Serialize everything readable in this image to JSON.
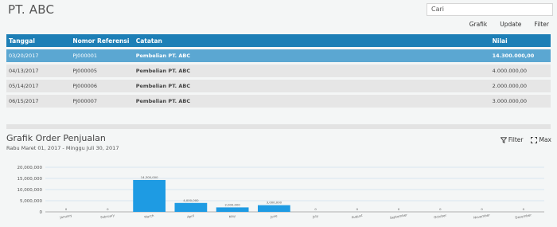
{
  "header": {
    "title": "PT. ABC",
    "search": {
      "value": "Cari"
    }
  },
  "toolbar": {
    "grafik": "Grafik",
    "update": "Update",
    "filter": "Filter"
  },
  "table": {
    "columns": [
      "Tanggal",
      "Nomor Referensi",
      "Catatan",
      "Nilai"
    ],
    "rows": [
      {
        "date": "03/20/2017",
        "ref": "PJ000001",
        "note": "Pembelian PT. ABC",
        "value": "14.300.000,00"
      },
      {
        "date": "04/13/2017",
        "ref": "PJ000005",
        "note": "Pembelian PT. ABC",
        "value": "4.000.000,00"
      },
      {
        "date": "05/14/2017",
        "ref": "PJ000006",
        "note": "Pembelian PT. ABC",
        "value": "2.000.000,00"
      },
      {
        "date": "06/15/2017",
        "ref": "PJ000007",
        "note": "Pembelian PT. ABC",
        "value": "3.000.000,00"
      }
    ]
  },
  "chart_section": {
    "title": "Grafik Order Penjualan",
    "subtitle": "Rabu Maret 01, 2017 - Minggu Juli 30, 2017",
    "filter_label": "Filter",
    "max_label": "Max"
  },
  "colors": {
    "header_blue": "#1d7fb6",
    "selected_blue": "#5ba7d2",
    "bar_blue": "#1e9be3"
  },
  "chart_data": {
    "type": "bar",
    "categories": [
      "January",
      "February",
      "March",
      "April",
      "May",
      "June",
      "July",
      "August",
      "September",
      "October",
      "November",
      "December"
    ],
    "values": [
      0,
      0,
      14300000,
      4000000,
      2000000,
      3000000,
      0,
      0,
      0,
      0,
      0,
      0
    ],
    "value_labels": [
      "0",
      "0",
      "14,300,000",
      "4,000,000",
      "2,000,000",
      "3,000,000",
      "0",
      "0",
      "0",
      "0",
      "0",
      "0"
    ],
    "y_ticks": [
      "20,000,000",
      "15,000,000",
      "10,000,000",
      "5,000,000",
      "0"
    ],
    "ylim": [
      0,
      20000000
    ],
    "grid": true
  }
}
